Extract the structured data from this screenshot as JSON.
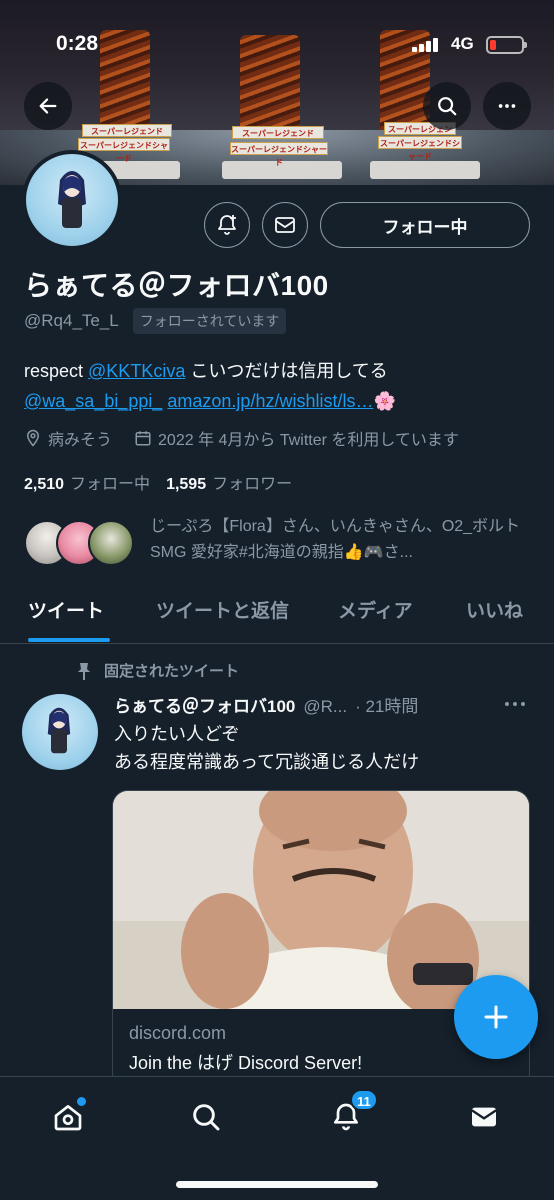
{
  "status_bar": {
    "time": "0:28",
    "network": "4G"
  },
  "banner": {
    "plates": [
      "スーパーレジェンド",
      "スーパーレジェンド",
      "スーパーレジェンド",
      "スーパーレジェンドシャード",
      "スーパーレジェンドシャード",
      "スーパーレジェンドシャード"
    ]
  },
  "profile": {
    "display_name": "らぁてる＠フォロバ100",
    "handle": "@Rq4_Te_L",
    "follows_you": "フォローされています",
    "follow_button": "フォロー中",
    "bio": {
      "prefix": "respect ",
      "mention1": "@KKTKciva",
      "middle": " こいつだけは信用してる",
      "mention2": "@wa_sa_bi_ppi_",
      "link": "amazon.jp/hz/wishlist/ls…",
      "emoji": "🌸"
    },
    "location": "病みそう",
    "joined": "2022 年 4月から Twitter を利用しています",
    "following_count": "2,510",
    "following_label": "フォロー中",
    "followers_count": "1,595",
    "followers_label": "フォロワー",
    "followed_by_text": "じーぷろ【Flora】さん、いんきゃさん、O2_ボルト SMG 愛好家#北海道の親指👍🎮さ..."
  },
  "tabs": [
    "ツイート",
    "ツイートと返信",
    "メディア",
    "いいね"
  ],
  "pinned": {
    "label": "固定されたツイート",
    "name": "らぁてる＠フォロバ100",
    "handle": "@R...",
    "time": "· 21時間",
    "text_line1": "入りたい人どぞ",
    "text_line2": "ある程度常識あって冗談通じる人だけ",
    "card_domain": "discord.com",
    "card_title": "Join the はげ Discord Server!"
  },
  "nav": {
    "notif_badge": "11"
  },
  "colors": {
    "accent": "#1d9bf0",
    "background": "#15202b",
    "muted": "#8b98a5"
  }
}
